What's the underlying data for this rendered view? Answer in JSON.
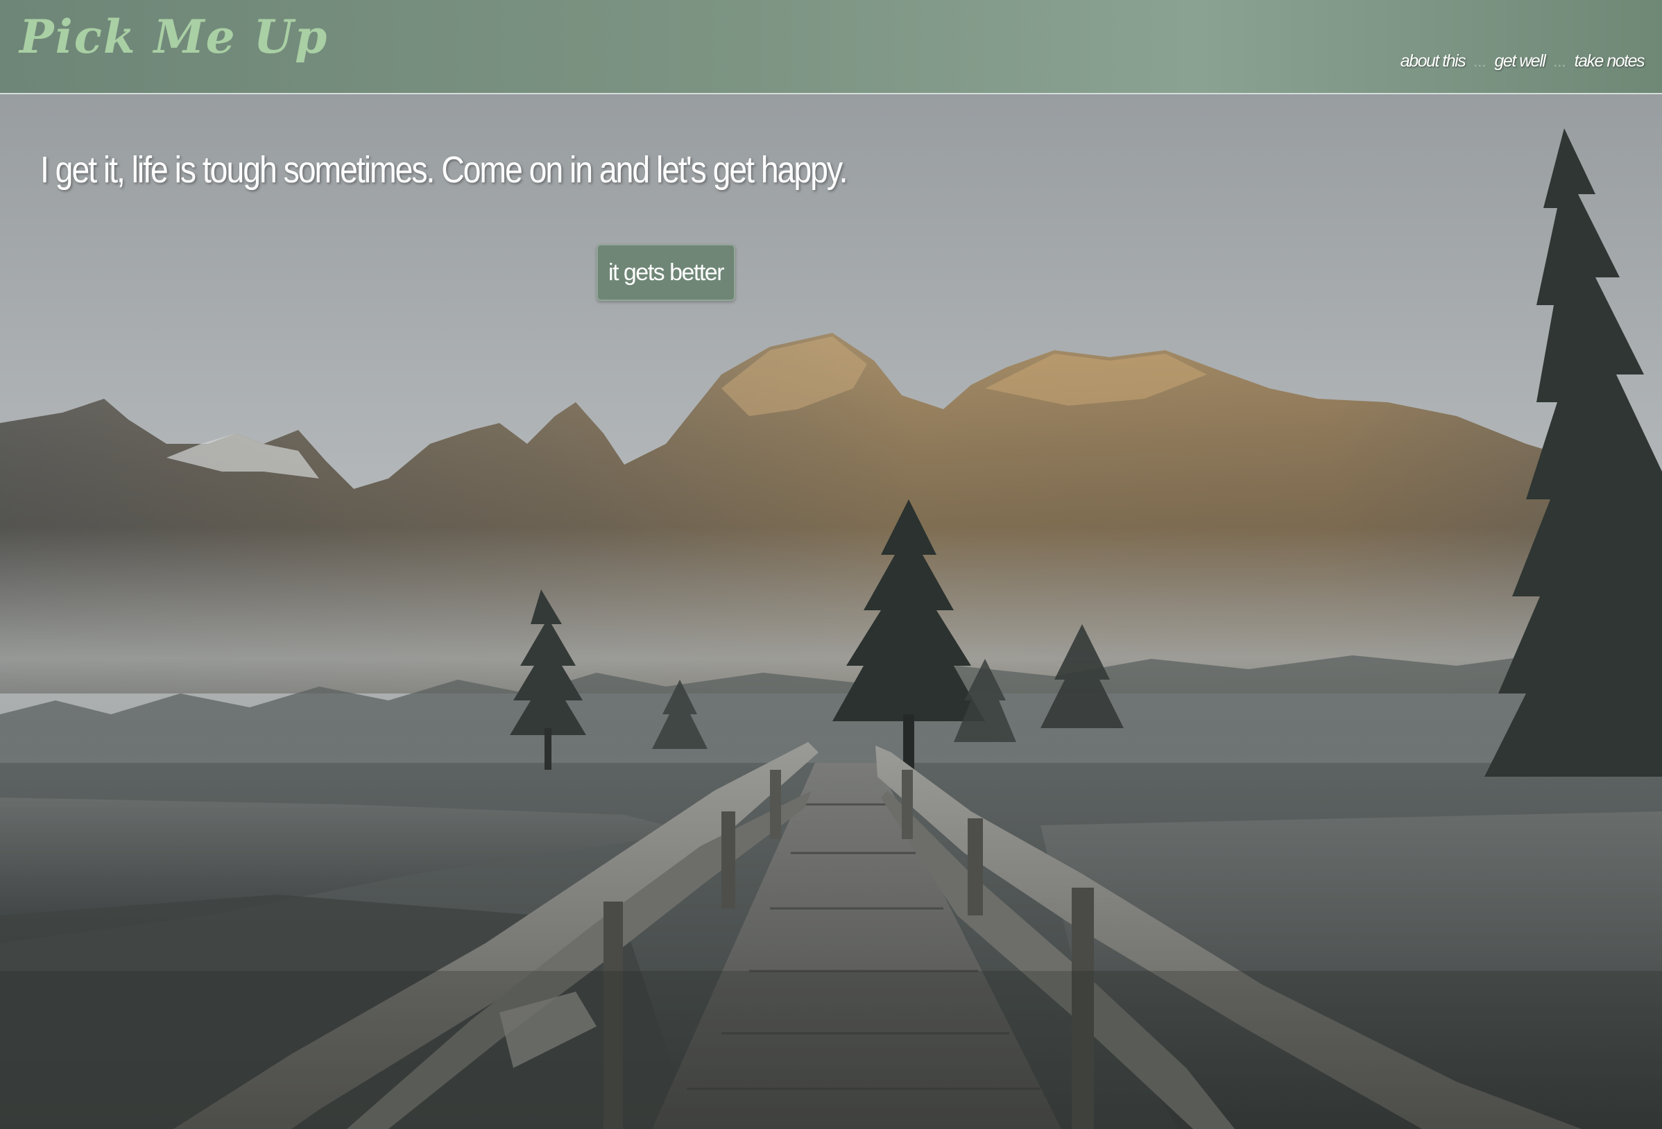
{
  "header": {
    "logo": "Pick Me Up",
    "nav": [
      {
        "label": "about this"
      },
      {
        "label": "get well"
      },
      {
        "label": "take notes"
      }
    ],
    "separator": "..."
  },
  "hero": {
    "tagline": "I get it, life is tough sometimes. Come on in and let's get happy.",
    "button_label": "it gets better"
  },
  "colors": {
    "header_bg": "#7d9483",
    "logo": "#a9cfa4",
    "button_bg": "#6f8676"
  }
}
